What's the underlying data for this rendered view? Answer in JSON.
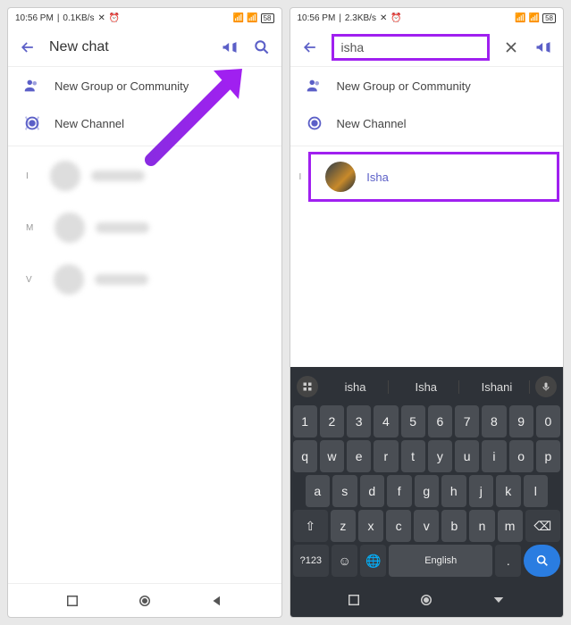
{
  "left": {
    "status": {
      "time": "10:56 PM",
      "net": "0.1KB/s"
    },
    "header": {
      "title": "New chat"
    },
    "options": {
      "group": "New Group or Community",
      "channel": "New Channel"
    },
    "letters": [
      "I",
      "M",
      "V"
    ]
  },
  "right": {
    "status": {
      "time": "10:56 PM",
      "net": "2.3KB/s"
    },
    "search": {
      "value": "isha"
    },
    "options": {
      "group": "New Group or Community",
      "channel": "New Channel"
    },
    "letters": [
      "I"
    ],
    "result": {
      "name": "Isha"
    },
    "keyboard": {
      "suggestions": [
        "isha",
        "Isha",
        "Ishani"
      ],
      "row1": [
        "1",
        "2",
        "3",
        "4",
        "5",
        "6",
        "7",
        "8",
        "9",
        "0"
      ],
      "row2": [
        "q",
        "w",
        "e",
        "r",
        "t",
        "y",
        "u",
        "i",
        "o",
        "p"
      ],
      "row3": [
        "a",
        "s",
        "d",
        "f",
        "g",
        "h",
        "j",
        "k",
        "l"
      ],
      "row4": [
        "z",
        "x",
        "c",
        "v",
        "b",
        "n",
        "m"
      ],
      "shift": "⇧",
      "backspace": "⌫",
      "sym": "?123",
      "emoji": "☺",
      "globe": "🌐",
      "space": "English",
      "period": "."
    }
  }
}
